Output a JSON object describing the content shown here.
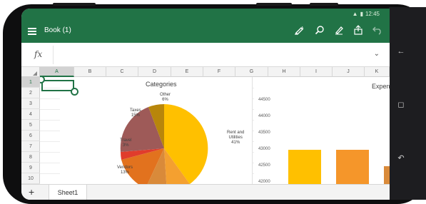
{
  "app": {
    "title": "Book (1)",
    "accent": "#217346",
    "status_time": "12:45"
  },
  "toolbar": {
    "icons": [
      "pen-icon",
      "search-icon",
      "draw-icon",
      "share-icon",
      "undo-icon"
    ]
  },
  "formula_bar": {
    "fx_label": "fx",
    "value": ""
  },
  "columns": [
    "A",
    "B",
    "C",
    "D",
    "E",
    "F",
    "G",
    "H",
    "I",
    "J",
    "K"
  ],
  "rows": [
    "1",
    "2",
    "3",
    "4",
    "5",
    "6",
    "7",
    "8",
    "9",
    "10"
  ],
  "selected_cell": "A1",
  "pie_chart": {
    "title": "Categories",
    "labels": [
      {
        "name": "Other",
        "pct": "6%"
      },
      {
        "name": "Taxes",
        "pct": "15%"
      },
      {
        "name": "Travel",
        "pct": "3%"
      },
      {
        "name": "Vendors",
        "pct": "13%"
      },
      {
        "name": "Rent and\nUtilities",
        "pct": "41%"
      }
    ],
    "colors": [
      "#ffc000",
      "#f4a030",
      "#f28a1a",
      "#e2721e",
      "#e03c2c",
      "#9e5a58",
      "#b8860b"
    ]
  },
  "chart_data": {
    "type": "bar",
    "title": "Expen",
    "yticks": [
      "44500",
      "44000",
      "43500",
      "43000",
      "42500",
      "42000"
    ],
    "values": [
      43000,
      43000,
      42500
    ],
    "colors": [
      "#ffc000",
      "#f5962a",
      "#d98a3a"
    ]
  },
  "sheets": [
    {
      "name": "Sheet1",
      "active": true
    }
  ],
  "add_sheet_label": "+"
}
